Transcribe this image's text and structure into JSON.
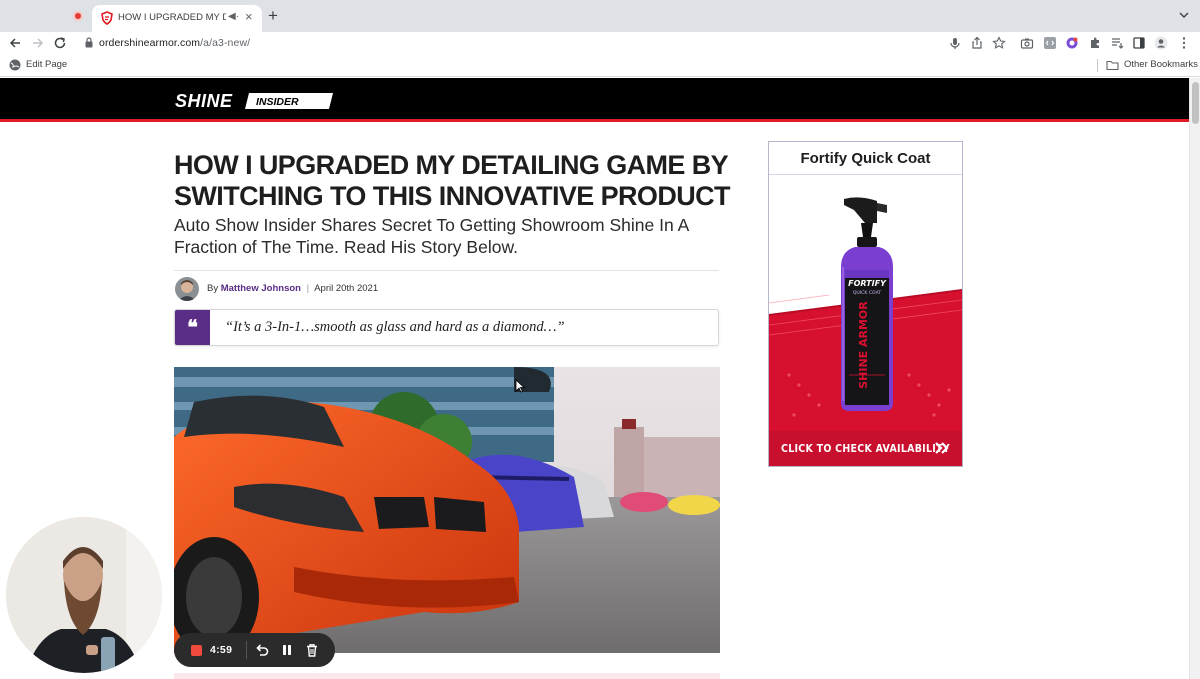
{
  "browser": {
    "active_tab_title": "HOW I UPGRADED MY DETAILING GAME BY SWITCHING TO THIS INNOVATIVE PRODUCT",
    "url_host": "ordershinearmor.com",
    "url_path": "/a/a3-new/",
    "bookmark": "Edit Page",
    "other_bookmarks": "Other Bookmarks"
  },
  "site": {
    "logo_main": "SHINE",
    "logo_sub": "INSIDER",
    "header_color": "#000000",
    "accent_color": "#e01b24"
  },
  "article": {
    "headline": "HOW I UPGRADED MY DETAILING GAME BY SWITCHING TO THIS INNOVATIVE PRODUCT",
    "subhead": "Auto Show Insider Shares Secret To Getting Showroom Shine In A Fraction of The Time. Read His Story Below.",
    "byline_prefix": "By",
    "author": "Matthew Johnson",
    "date": "April 20th 2021",
    "quote": "“It’s a 3-In-1…smooth as glass and hard as a diamond…”",
    "quote_color": "#5a2d86"
  },
  "ad": {
    "title": "Fortify Quick Coat",
    "bottle_label_top": "FORTIFY",
    "bottle_label_sub": "QUICK COAT",
    "bottle_brand": "SHINE ARMOR",
    "cta": "CLICK TO CHECK AVAILABILITY",
    "cta_color": "#c8102e"
  },
  "recorder": {
    "time": "4:59"
  }
}
